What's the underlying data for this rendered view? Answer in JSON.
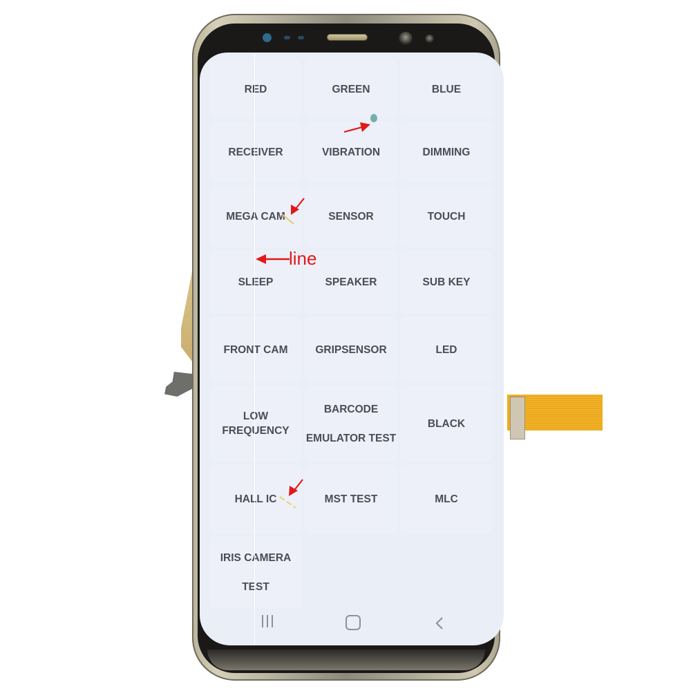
{
  "phone": {
    "screen": {
      "test_menu": [
        {
          "label": "RED"
        },
        {
          "label": "GREEN"
        },
        {
          "label": "BLUE"
        },
        {
          "label": "RECEIVER"
        },
        {
          "label": "VIBRATION"
        },
        {
          "label": "DIMMING"
        },
        {
          "label": "MEGA CAM"
        },
        {
          "label": "SENSOR"
        },
        {
          "label": "TOUCH"
        },
        {
          "label": "SLEEP"
        },
        {
          "label": "SPEAKER"
        },
        {
          "label": "SUB KEY"
        },
        {
          "label": "FRONT CAM"
        },
        {
          "label": "GRIPSENSOR"
        },
        {
          "label": "LED"
        },
        {
          "label": "LOW FREQUENCY"
        },
        {
          "label": "BARCODE\nEMULATOR TEST"
        },
        {
          "label": "BLACK"
        },
        {
          "label": "HALL IC"
        },
        {
          "label": "MST TEST"
        },
        {
          "label": "MLC"
        },
        {
          "label": "IRIS CAMERA\nTEST"
        }
      ],
      "navbar": {
        "recents_icon": "recents-icon",
        "home_icon": "home-icon",
        "back_icon": "back-chevron-icon"
      }
    }
  },
  "annotations": {
    "line_label": "line",
    "arrow_color": "#e0191b",
    "defects": [
      "green spot",
      "yellow scratch",
      "white vertical line",
      "yellow scratch"
    ]
  }
}
